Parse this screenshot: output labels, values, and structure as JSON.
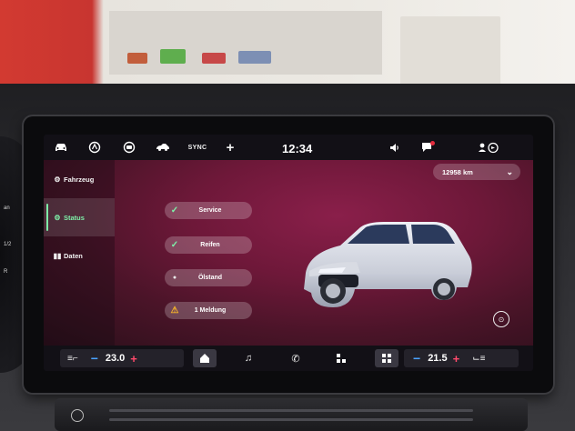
{
  "topbar": {
    "icons": [
      "car-icon",
      "driver-assist-icon",
      "camera-icon",
      "car-side-icon",
      "sync-icon",
      "plus-icon",
      "volume-icon",
      "notification-icon",
      "voice-nav-icon"
    ],
    "sync_label": "SYNC",
    "time": "12:34"
  },
  "sidebar": {
    "items": [
      {
        "label": "Fahrzeug",
        "icon": "car-settings-icon",
        "active": false
      },
      {
        "label": "Status",
        "icon": "status-icon",
        "active": true
      },
      {
        "label": "Daten",
        "icon": "data-icon",
        "active": false
      }
    ]
  },
  "odometer": {
    "value": "12958 km"
  },
  "status_items": [
    {
      "label": "Service",
      "icon": "check-icon"
    },
    {
      "label": "Reifen",
      "icon": "check-icon"
    },
    {
      "label": "Ölstand",
      "icon": "dot-icon"
    },
    {
      "label": "1 Meldung",
      "icon": "warning-icon"
    }
  ],
  "climate": {
    "left_temp": "23.0",
    "right_temp": "21.5"
  },
  "colors": {
    "accent_green": "#7ef0a8",
    "minus_blue": "#4aa3ff",
    "plus_red": "#ff4a6b",
    "warning_yellow": "#f5b32a"
  }
}
